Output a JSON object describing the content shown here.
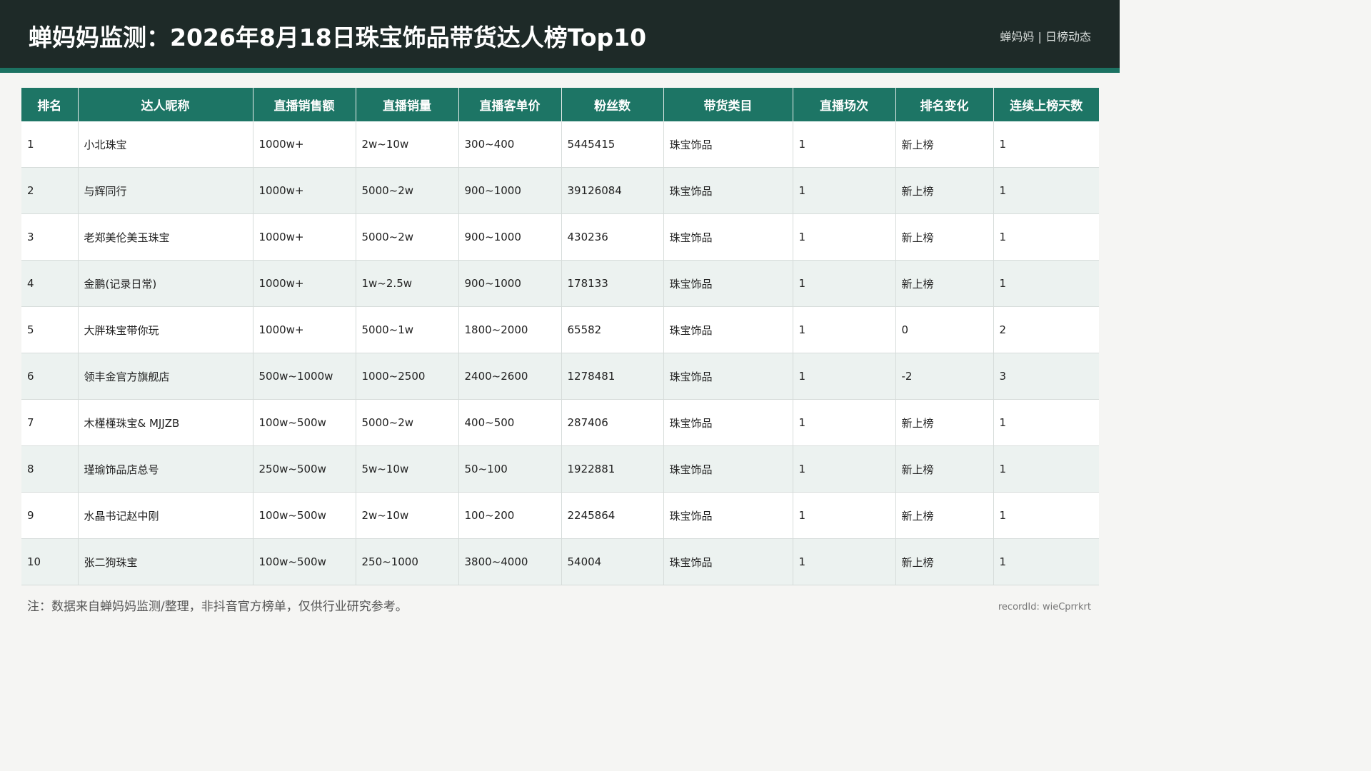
{
  "header": {
    "title": "蝉妈妈监测：2026年8月18日珠宝饰品带货达人榜Top10",
    "brand": "蝉妈妈 | 日榜动态"
  },
  "table": {
    "columns": [
      "排名",
      "达人昵称",
      "直播销售额",
      "直播销量",
      "直播客单价",
      "粉丝数",
      "带货类目",
      "直播场次",
      "排名变化",
      "连续上榜天数"
    ],
    "rows": [
      [
        "1",
        "小北珠宝",
        "1000w+",
        "2w~10w",
        "300~400",
        "5445415",
        "珠宝饰品",
        "1",
        "新上榜",
        "1"
      ],
      [
        "2",
        "与辉同行",
        "1000w+",
        "5000~2w",
        "900~1000",
        "39126084",
        "珠宝饰品",
        "1",
        "新上榜",
        "1"
      ],
      [
        "3",
        "老郑美伦美玉珠宝",
        "1000w+",
        "5000~2w",
        "900~1000",
        "430236",
        "珠宝饰品",
        "1",
        "新上榜",
        "1"
      ],
      [
        "4",
        "金鹏(记录日常)",
        "1000w+",
        "1w~2.5w",
        "900~1000",
        "178133",
        "珠宝饰品",
        "1",
        "新上榜",
        "1"
      ],
      [
        "5",
        "大胖珠宝带你玩",
        "1000w+",
        "5000~1w",
        "1800~2000",
        "65582",
        "珠宝饰品",
        "1",
        "0",
        "2"
      ],
      [
        "6",
        "领丰金官方旗舰店",
        "500w~1000w",
        "1000~2500",
        "2400~2600",
        "1278481",
        "珠宝饰品",
        "1",
        "-2",
        "3"
      ],
      [
        "7",
        "木槿槿珠宝& MJJZB",
        "100w~500w",
        "5000~2w",
        "400~500",
        "287406",
        "珠宝饰品",
        "1",
        "新上榜",
        "1"
      ],
      [
        "8",
        "瑾瑜饰品店总号",
        "250w~500w",
        "5w~10w",
        "50~100",
        "1922881",
        "珠宝饰品",
        "1",
        "新上榜",
        "1"
      ],
      [
        "9",
        "水晶书记赵中刚",
        "100w~500w",
        "2w~10w",
        "100~200",
        "2245864",
        "珠宝饰品",
        "1",
        "新上榜",
        "1"
      ],
      [
        "10",
        "张二狗珠宝",
        "100w~500w",
        "250~1000",
        "3800~4000",
        "54004",
        "珠宝饰品",
        "1",
        "新上榜",
        "1"
      ]
    ]
  },
  "footer": {
    "note": "注：数据来自蝉妈妈监测/整理，非抖音官方榜单，仅供行业研究参考。",
    "record": "recordId: wieCprrkrt"
  },
  "colors": {
    "header_bg": "#1e2a28",
    "accent": "#1c7262",
    "table_header": "#1d7565",
    "row_alt": "#ecf2f0"
  }
}
